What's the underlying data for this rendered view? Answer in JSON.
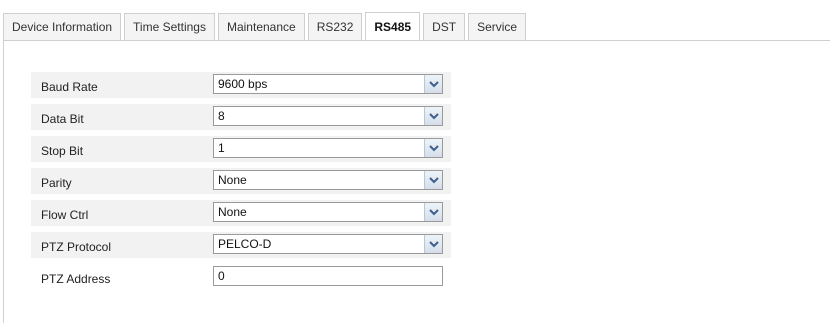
{
  "tabs": [
    {
      "label": "Device Information",
      "active": false
    },
    {
      "label": "Time Settings",
      "active": false
    },
    {
      "label": "Maintenance",
      "active": false
    },
    {
      "label": "RS232",
      "active": false
    },
    {
      "label": "RS485",
      "active": true
    },
    {
      "label": "DST",
      "active": false
    },
    {
      "label": "Service",
      "active": false
    }
  ],
  "form": {
    "baud_rate": {
      "label": "Baud Rate",
      "value": "9600 bps"
    },
    "data_bit": {
      "label": "Data Bit",
      "value": "8"
    },
    "stop_bit": {
      "label": "Stop Bit",
      "value": "1"
    },
    "parity": {
      "label": "Parity",
      "value": "None"
    },
    "flow_ctrl": {
      "label": "Flow Ctrl",
      "value": "None"
    },
    "ptz_protocol": {
      "label": "PTZ Protocol",
      "value": "PELCO-D"
    },
    "ptz_address": {
      "label": "PTZ Address",
      "value": "0"
    }
  },
  "icons": {
    "dropdown": "chevron-down-icon"
  },
  "colors": {
    "row_shade": "#f2f2f2",
    "border": "#cfcfcf",
    "chevron": "#3b5f8a"
  }
}
